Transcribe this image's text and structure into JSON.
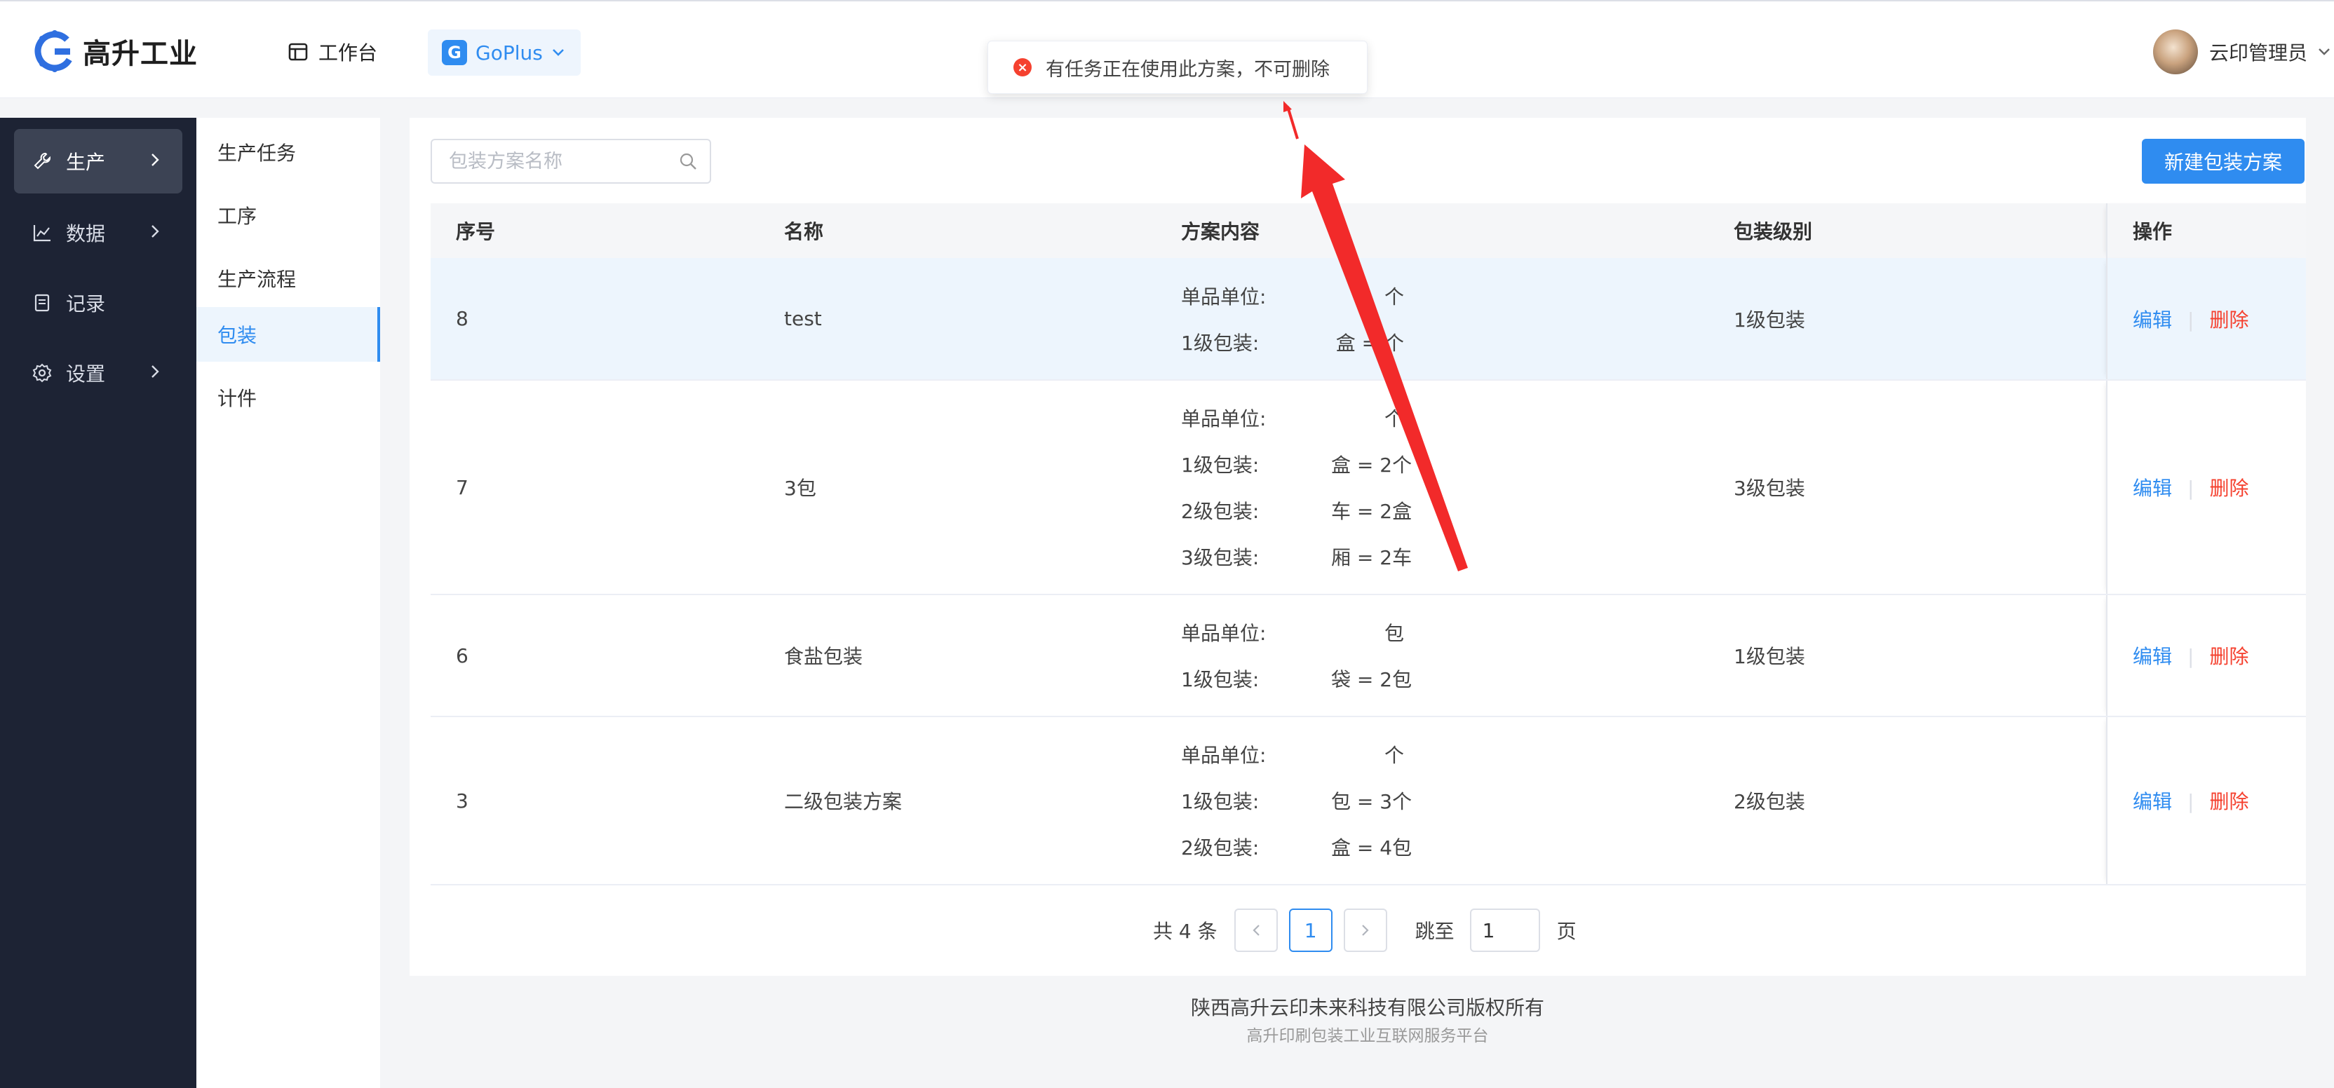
{
  "header": {
    "brand": "高升工业",
    "workbench_label": "工作台",
    "app_switch_label": "GoPlus",
    "app_switch_icon": "G",
    "user_name": "云印管理员"
  },
  "toast": {
    "type": "error",
    "message": "有任务正在使用此方案，不可删除"
  },
  "sidebar": {
    "items": [
      {
        "label": "生产",
        "icon": "wrench-icon",
        "active": true,
        "has_children": true
      },
      {
        "label": "数据",
        "icon": "line-chart-icon",
        "active": false,
        "has_children": true
      },
      {
        "label": "记录",
        "icon": "document-icon",
        "active": false,
        "has_children": false
      },
      {
        "label": "设置",
        "icon": "gear-icon",
        "active": false,
        "has_children": true
      }
    ]
  },
  "submenu": {
    "items": [
      {
        "label": "生产任务",
        "active": false
      },
      {
        "label": "工序",
        "active": false
      },
      {
        "label": "生产流程",
        "active": false
      },
      {
        "label": "包装",
        "active": true
      },
      {
        "label": "计件",
        "active": false
      }
    ]
  },
  "toolbar": {
    "search_placeholder": "包装方案名称",
    "new_button_label": "新建包装方案"
  },
  "table": {
    "columns": [
      "序号",
      "名称",
      "方案内容",
      "包装级别",
      "操作"
    ],
    "action_edit": "编辑",
    "action_delete": "删除",
    "rows": [
      {
        "id": "8",
        "name": "test",
        "level": "1级包装",
        "highlighted": true,
        "content": [
          {
            "label": "单品单位:",
            "value": "个"
          },
          {
            "label": "1级包装:",
            "value": "盒 = 个"
          }
        ]
      },
      {
        "id": "7",
        "name": "3包",
        "level": "3级包装",
        "highlighted": false,
        "content": [
          {
            "label": "单品单位:",
            "value": "个"
          },
          {
            "label": "1级包装:",
            "value": "盒 = 2个"
          },
          {
            "label": "2级包装:",
            "value": "车 = 2盒"
          },
          {
            "label": "3级包装:",
            "value": "厢 = 2车"
          }
        ]
      },
      {
        "id": "6",
        "name": "食盐包装",
        "level": "1级包装",
        "highlighted": false,
        "content": [
          {
            "label": "单品单位:",
            "value": "包"
          },
          {
            "label": "1级包装:",
            "value": "袋 = 2包"
          }
        ]
      },
      {
        "id": "3",
        "name": "二级包装方案",
        "level": "2级包装",
        "highlighted": false,
        "content": [
          {
            "label": "单品单位:",
            "value": "个"
          },
          {
            "label": "1级包装:",
            "value": "包 = 3个"
          },
          {
            "label": "2级包装:",
            "value": "盒 = 4包"
          }
        ]
      }
    ]
  },
  "pagination": {
    "total_label": "共 4 条",
    "current_page": "1",
    "jump_label": "跳至",
    "jump_value": "1",
    "page_unit": "页"
  },
  "footer": {
    "copyright": "陕西高升云印未来科技有限公司版权所有",
    "subtitle": "高升印刷包装工业互联网服务平台"
  },
  "colors": {
    "primary": "#2f8cf0",
    "danger": "#f5412f",
    "sidebar_bg": "#1d2334",
    "annotation_arrow": "#f22a2a"
  }
}
